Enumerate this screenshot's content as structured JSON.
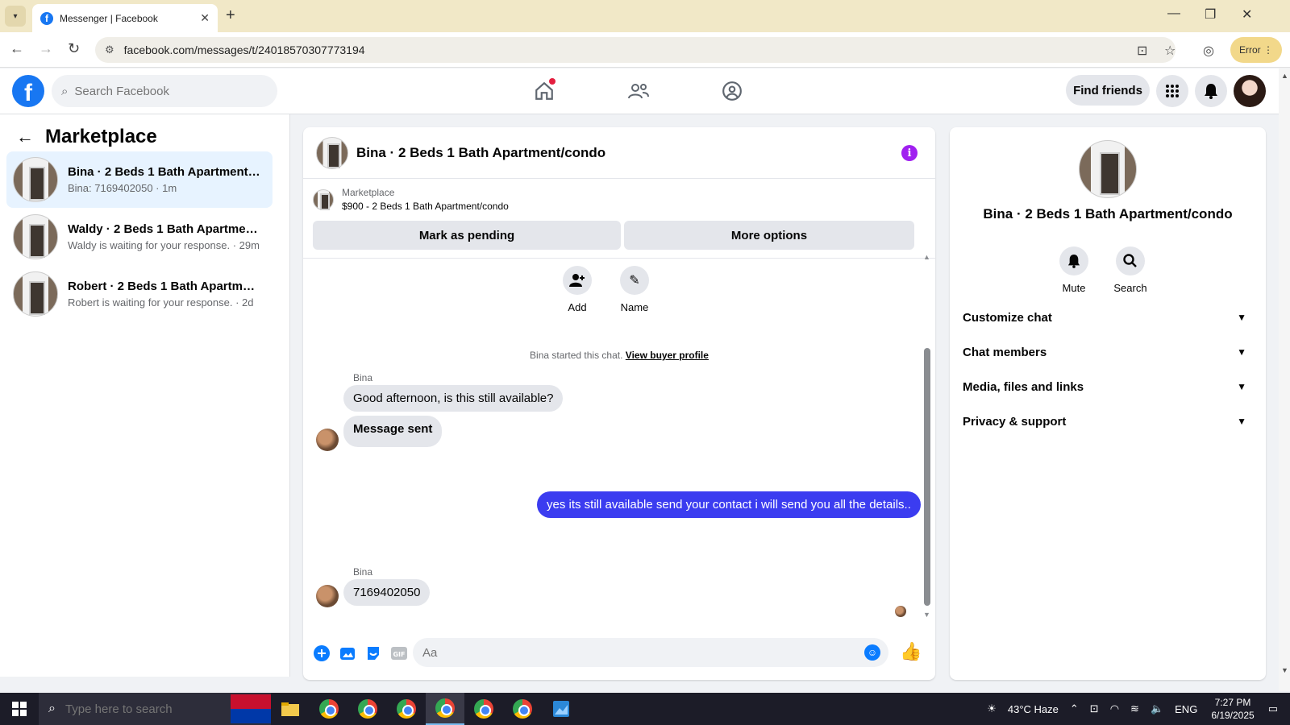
{
  "browser": {
    "tab_title": "Messenger | Facebook",
    "url": "facebook.com/messages/t/24018570307773194",
    "profile_label": "Error"
  },
  "fb_header": {
    "search_placeholder": "Search Facebook",
    "find_friends": "Find friends"
  },
  "sidebar": {
    "title": "Marketplace",
    "conversations": [
      {
        "name": "Bina · 2 Beds 1 Bath Apartment/...",
        "preview": "Bina: 7169402050 · 1m"
      },
      {
        "name": "Waldy · 2 Beds 1 Bath Apartmen...",
        "preview": "Waldy is waiting for your response. · 29m"
      },
      {
        "name": "Robert · 2 Beds 1 Bath Apartmen...",
        "preview": "Robert is waiting for your response. · 2d"
      }
    ]
  },
  "chat": {
    "title": "Bina · 2 Beds 1 Bath Apartment/condo",
    "listing_label": "Marketplace",
    "listing_value": "$900 - 2 Beds 1 Bath Apartment/condo",
    "mark_pending": "Mark as pending",
    "more_options": "More options",
    "quick_add": "Add",
    "quick_name": "Name",
    "system_text": "Bina started this chat.",
    "system_link": "View buyer profile",
    "messages": [
      {
        "sender": "Bina",
        "text": "Good afternoon, is this still available?"
      },
      {
        "sender": "",
        "text": "Message sent"
      },
      {
        "sender": "me",
        "text": "yes its still available send your contact i will send you all the details.."
      },
      {
        "sender": "Bina",
        "text": "7169402050"
      }
    ],
    "composer_placeholder": "Aa"
  },
  "info_panel": {
    "title": "Bina · 2 Beds 1 Bath Apartment/condo",
    "mute": "Mute",
    "search": "Search",
    "sections": [
      "Customize chat",
      "Chat members",
      "Media, files and links",
      "Privacy & support"
    ]
  },
  "taskbar": {
    "search_placeholder": "Type here to search",
    "weather": "43°C  Haze",
    "lang": "ENG",
    "time": "7:27 PM",
    "date": "6/19/2025"
  },
  "colors": {
    "fb_blue": "#1877f2",
    "outgoing_bubble": "#3b3cf0",
    "info_purple": "#a020f0"
  }
}
